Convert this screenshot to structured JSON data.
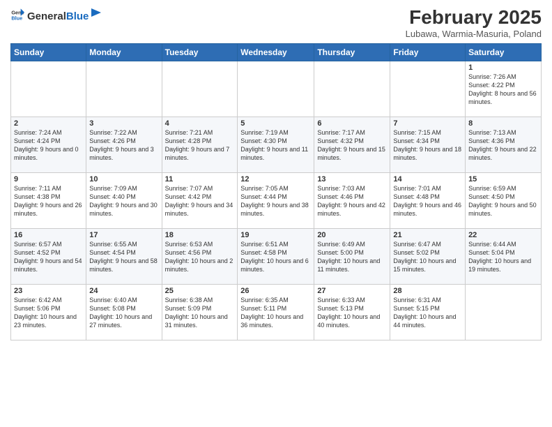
{
  "header": {
    "logo_general": "General",
    "logo_blue": "Blue",
    "title": "February 2025",
    "subtitle": "Lubawa, Warmia-Masuria, Poland"
  },
  "days_of_week": [
    "Sunday",
    "Monday",
    "Tuesday",
    "Wednesday",
    "Thursday",
    "Friday",
    "Saturday"
  ],
  "weeks": [
    [
      {
        "day": "",
        "info": ""
      },
      {
        "day": "",
        "info": ""
      },
      {
        "day": "",
        "info": ""
      },
      {
        "day": "",
        "info": ""
      },
      {
        "day": "",
        "info": ""
      },
      {
        "day": "",
        "info": ""
      },
      {
        "day": "1",
        "info": "Sunrise: 7:26 AM\nSunset: 4:22 PM\nDaylight: 8 hours and 56 minutes."
      }
    ],
    [
      {
        "day": "2",
        "info": "Sunrise: 7:24 AM\nSunset: 4:24 PM\nDaylight: 9 hours and 0 minutes."
      },
      {
        "day": "3",
        "info": "Sunrise: 7:22 AM\nSunset: 4:26 PM\nDaylight: 9 hours and 3 minutes."
      },
      {
        "day": "4",
        "info": "Sunrise: 7:21 AM\nSunset: 4:28 PM\nDaylight: 9 hours and 7 minutes."
      },
      {
        "day": "5",
        "info": "Sunrise: 7:19 AM\nSunset: 4:30 PM\nDaylight: 9 hours and 11 minutes."
      },
      {
        "day": "6",
        "info": "Sunrise: 7:17 AM\nSunset: 4:32 PM\nDaylight: 9 hours and 15 minutes."
      },
      {
        "day": "7",
        "info": "Sunrise: 7:15 AM\nSunset: 4:34 PM\nDaylight: 9 hours and 18 minutes."
      },
      {
        "day": "8",
        "info": "Sunrise: 7:13 AM\nSunset: 4:36 PM\nDaylight: 9 hours and 22 minutes."
      }
    ],
    [
      {
        "day": "9",
        "info": "Sunrise: 7:11 AM\nSunset: 4:38 PM\nDaylight: 9 hours and 26 minutes."
      },
      {
        "day": "10",
        "info": "Sunrise: 7:09 AM\nSunset: 4:40 PM\nDaylight: 9 hours and 30 minutes."
      },
      {
        "day": "11",
        "info": "Sunrise: 7:07 AM\nSunset: 4:42 PM\nDaylight: 9 hours and 34 minutes."
      },
      {
        "day": "12",
        "info": "Sunrise: 7:05 AM\nSunset: 4:44 PM\nDaylight: 9 hours and 38 minutes."
      },
      {
        "day": "13",
        "info": "Sunrise: 7:03 AM\nSunset: 4:46 PM\nDaylight: 9 hours and 42 minutes."
      },
      {
        "day": "14",
        "info": "Sunrise: 7:01 AM\nSunset: 4:48 PM\nDaylight: 9 hours and 46 minutes."
      },
      {
        "day": "15",
        "info": "Sunrise: 6:59 AM\nSunset: 4:50 PM\nDaylight: 9 hours and 50 minutes."
      }
    ],
    [
      {
        "day": "16",
        "info": "Sunrise: 6:57 AM\nSunset: 4:52 PM\nDaylight: 9 hours and 54 minutes."
      },
      {
        "day": "17",
        "info": "Sunrise: 6:55 AM\nSunset: 4:54 PM\nDaylight: 9 hours and 58 minutes."
      },
      {
        "day": "18",
        "info": "Sunrise: 6:53 AM\nSunset: 4:56 PM\nDaylight: 10 hours and 2 minutes."
      },
      {
        "day": "19",
        "info": "Sunrise: 6:51 AM\nSunset: 4:58 PM\nDaylight: 10 hours and 6 minutes."
      },
      {
        "day": "20",
        "info": "Sunrise: 6:49 AM\nSunset: 5:00 PM\nDaylight: 10 hours and 11 minutes."
      },
      {
        "day": "21",
        "info": "Sunrise: 6:47 AM\nSunset: 5:02 PM\nDaylight: 10 hours and 15 minutes."
      },
      {
        "day": "22",
        "info": "Sunrise: 6:44 AM\nSunset: 5:04 PM\nDaylight: 10 hours and 19 minutes."
      }
    ],
    [
      {
        "day": "23",
        "info": "Sunrise: 6:42 AM\nSunset: 5:06 PM\nDaylight: 10 hours and 23 minutes."
      },
      {
        "day": "24",
        "info": "Sunrise: 6:40 AM\nSunset: 5:08 PM\nDaylight: 10 hours and 27 minutes."
      },
      {
        "day": "25",
        "info": "Sunrise: 6:38 AM\nSunset: 5:09 PM\nDaylight: 10 hours and 31 minutes."
      },
      {
        "day": "26",
        "info": "Sunrise: 6:35 AM\nSunset: 5:11 PM\nDaylight: 10 hours and 36 minutes."
      },
      {
        "day": "27",
        "info": "Sunrise: 6:33 AM\nSunset: 5:13 PM\nDaylight: 10 hours and 40 minutes."
      },
      {
        "day": "28",
        "info": "Sunrise: 6:31 AM\nSunset: 5:15 PM\nDaylight: 10 hours and 44 minutes."
      },
      {
        "day": "",
        "info": ""
      }
    ]
  ]
}
